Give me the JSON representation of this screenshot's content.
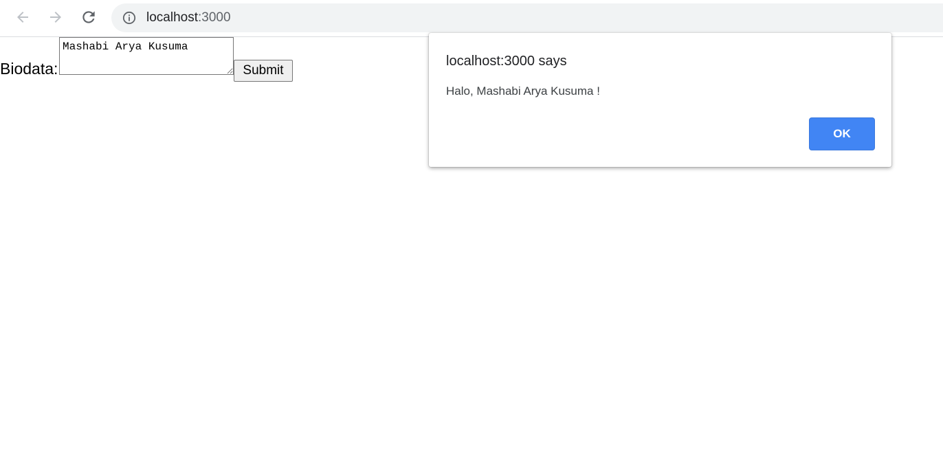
{
  "browser": {
    "url_host": "localhost",
    "url_port": ":3000",
    "icons": {
      "back": "arrow-left-icon",
      "forward": "arrow-right-icon",
      "reload": "reload-icon",
      "info": "info-icon"
    }
  },
  "form": {
    "label": "Biodata:",
    "textarea_value": "Mashabi Arya Kusuma",
    "submit_label": "Submit"
  },
  "dialog": {
    "title": "localhost:3000 says",
    "message": "Halo, Mashabi Arya Kusuma !",
    "ok_label": "OK",
    "accent_color": "#4185f4"
  }
}
